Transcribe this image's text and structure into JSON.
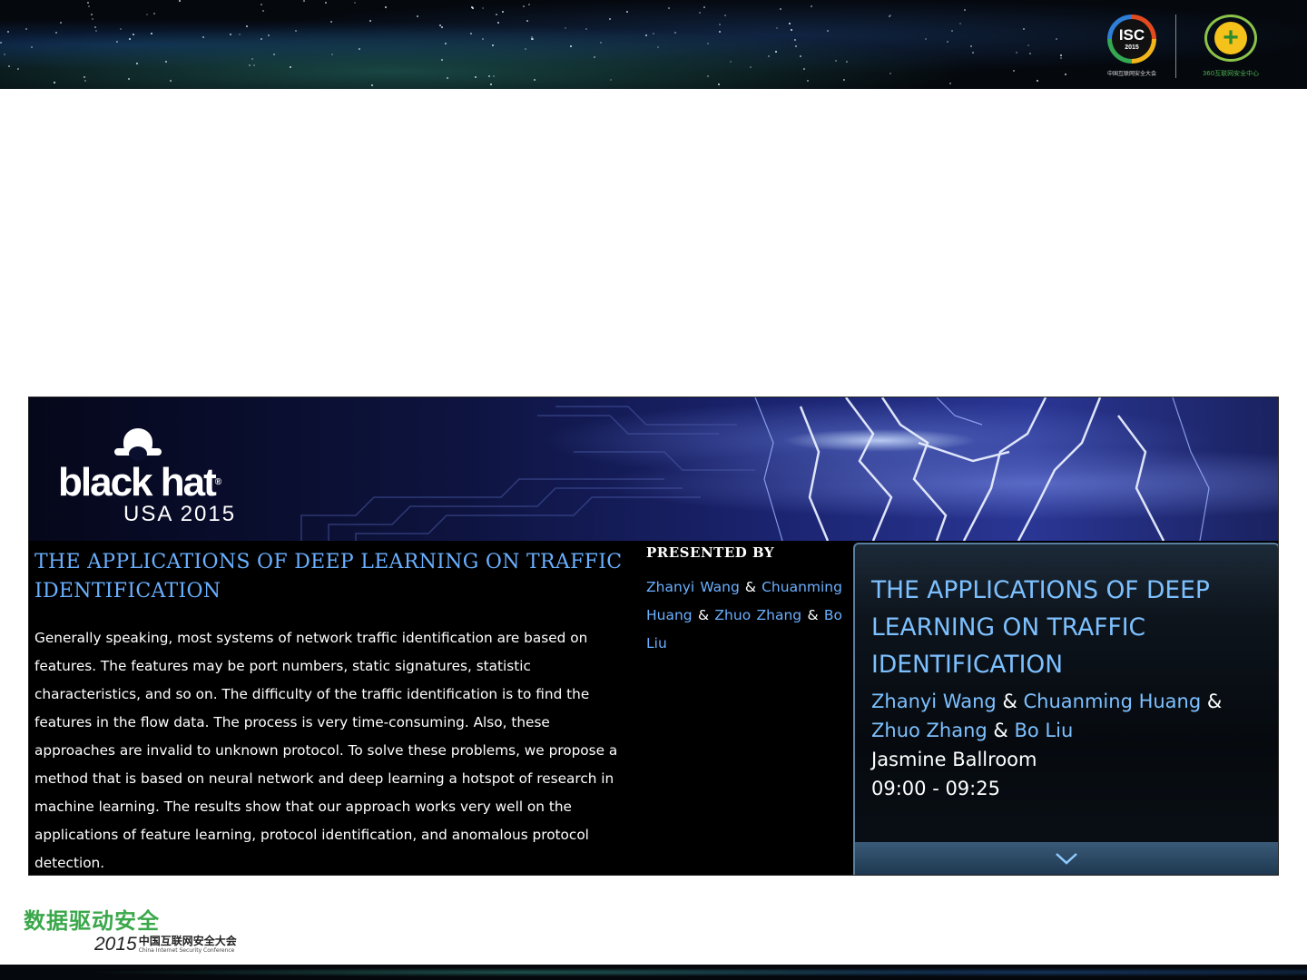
{
  "header": {
    "isc_logo": {
      "mark": "ISC",
      "year": "2015",
      "caption": "中国互联网安全大会"
    },
    "c360_logo": {
      "caption": "360互联网安全中心"
    }
  },
  "banner": {
    "brand": "black hat",
    "edition": "USA 2015"
  },
  "session": {
    "title": "THE APPLICATIONS OF DEEP LEARNING ON TRAFFIC IDENTIFICATION",
    "abstract": "Generally speaking, most systems of network traffic identification are based on features. The features may be port numbers, static signatures, statistic characteristics, and so on. The difficulty of the traffic identification is to find the features in the flow data. The process is very time-consuming. Also, these approaches are invalid to unknown protocol. To solve these problems, we propose a method that is based on neural network and deep learning a hotspot of research in machine learning. The results show that our approach works very well on the applications of feature learning, protocol identification, and anomalous protocol detection.",
    "presented_by_label": "PRESENTED BY",
    "authors": [
      "Zhanyi Wang",
      "Chuanming Huang",
      "Zhuo Zhang",
      "Bo Liu"
    ],
    "separator": "&"
  },
  "card": {
    "title": "THE APPLICATIONS OF DEEP LEARNING ON TRAFFIC IDENTIFICATION",
    "authors": [
      "Zhanyi Wang",
      "Chuanming Huang",
      "Zhuo Zhang",
      "Bo Liu"
    ],
    "room": "Jasmine Ballroom",
    "time": "09:00 - 09:25",
    "expand_icon": "chevron-down-icon"
  },
  "footer": {
    "slogan": "数据驱动安全",
    "year": "2015",
    "conference_cn": "中国互联网安全大会",
    "conference_en": "China Internet Security Conference"
  },
  "colors": {
    "accent_blue": "#6ab0ff",
    "slogan_green": "#3aa84a"
  }
}
